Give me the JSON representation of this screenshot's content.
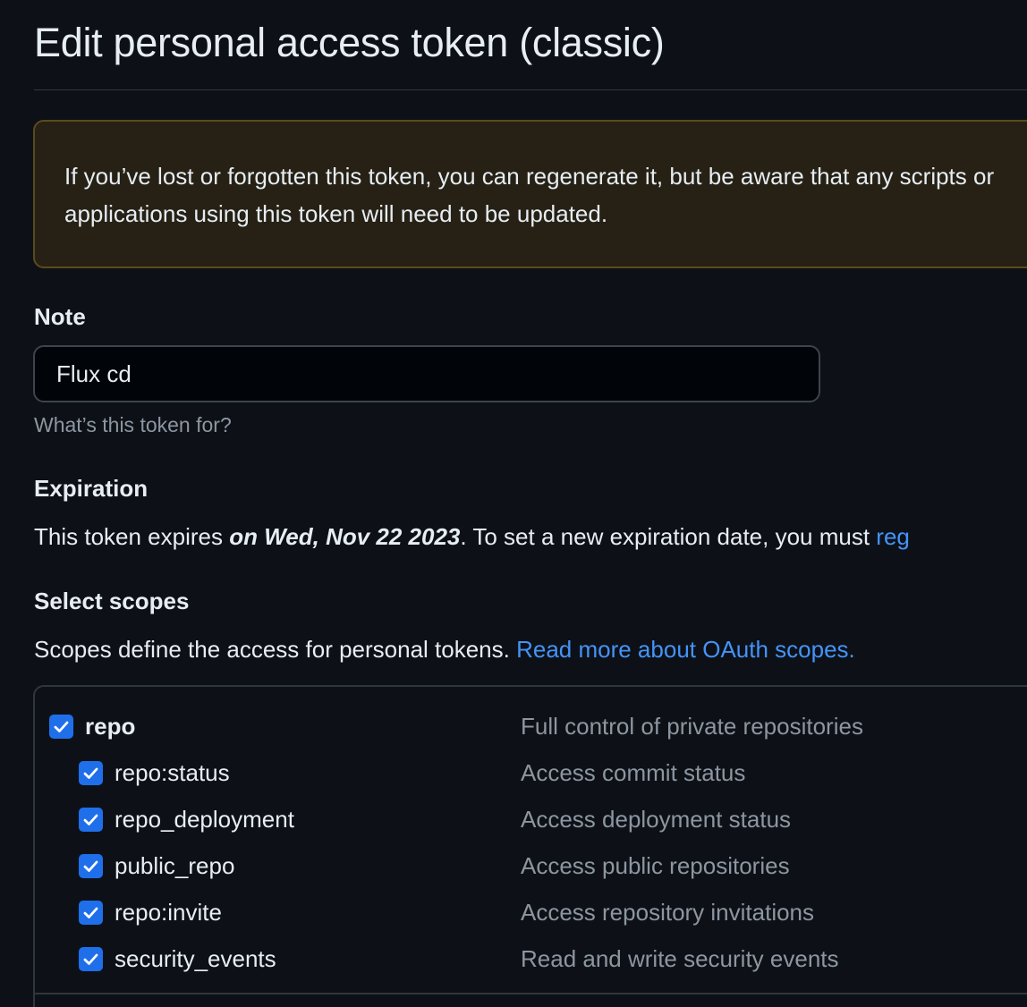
{
  "page": {
    "title": "Edit personal access token (classic)"
  },
  "flash": {
    "message": "If you’ve lost or forgotten this token, you can regenerate it, but be aware that any scripts or applications using this token will need to be updated."
  },
  "note": {
    "label": "Note",
    "value": "Flux cd",
    "hint": "What’s this token for?"
  },
  "expiration": {
    "label": "Expiration",
    "text_before": "This token expires ",
    "date_text": "on Wed, Nov 22 2023",
    "text_after": ". To set a new expiration date, you must ",
    "link_text": "reg"
  },
  "scopes": {
    "label": "Select scopes",
    "description": "Scopes define the access for personal tokens. ",
    "link_text": "Read more about OAuth scopes.",
    "items": [
      {
        "name": "repo",
        "description": "Full control of private repositories",
        "checked": true
      },
      {
        "name": "repo:status",
        "description": "Access commit status",
        "checked": true
      },
      {
        "name": "repo_deployment",
        "description": "Access deployment status",
        "checked": true
      },
      {
        "name": "public_repo",
        "description": "Access public repositories",
        "checked": true
      },
      {
        "name": "repo:invite",
        "description": "Access repository invitations",
        "checked": true
      },
      {
        "name": "security_events",
        "description": "Read and write security events",
        "checked": true
      }
    ]
  },
  "colors": {
    "background": "#0d1117",
    "accent": "#4493f8",
    "checkbox": "#1f6feb",
    "warning_bg": "#272115",
    "warning_border": "#5b4a1b"
  }
}
